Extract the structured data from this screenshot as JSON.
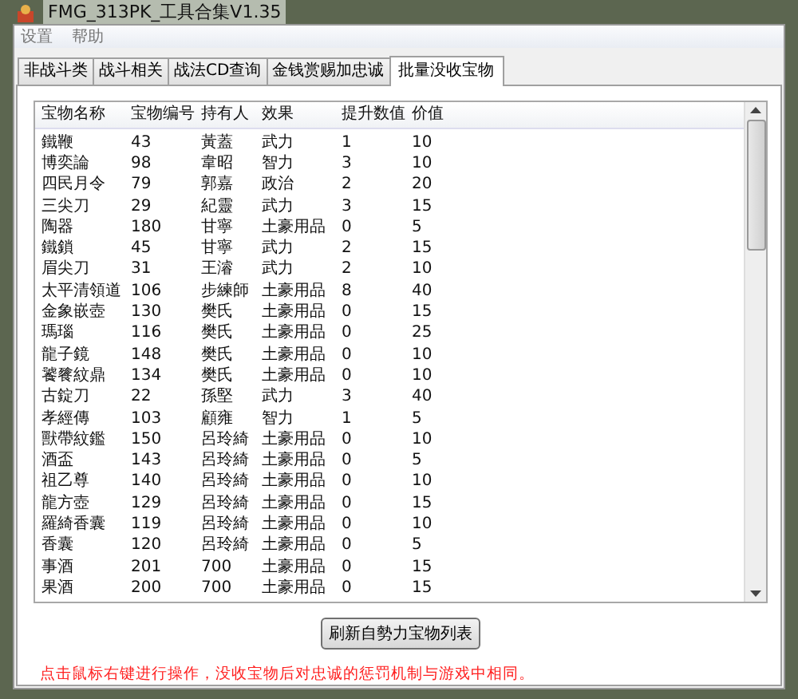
{
  "window": {
    "title": "FMG_313PK_工具合集V1.35"
  },
  "menu": [
    "设置",
    "帮助"
  ],
  "tabs": [
    {
      "label": "非战斗类",
      "selected": false
    },
    {
      "label": "战斗相关",
      "selected": false
    },
    {
      "label": "战法CD查询",
      "selected": false
    },
    {
      "label": "金钱赏赐加忠诚",
      "selected": false
    },
    {
      "label": "批量没收宝物",
      "selected": true
    }
  ],
  "table": {
    "columns": [
      "宝物名称",
      "宝物编号",
      "持有人",
      "效果",
      "提升数值",
      "价值"
    ],
    "rows": [
      [
        "鐵鞭",
        "43",
        "黃蓋",
        "武力",
        "1",
        "10"
      ],
      [
        "博奕論",
        "98",
        "韋昭",
        "智力",
        "3",
        "10"
      ],
      [
        "四民月令",
        "79",
        "郭嘉",
        "政治",
        "2",
        "20"
      ],
      [
        "三尖刀",
        "29",
        "紀靈",
        "武力",
        "3",
        "15"
      ],
      [
        "陶器",
        "180",
        "甘寧",
        "土豪用品",
        "0",
        "5"
      ],
      [
        "鐵鎖",
        "45",
        "甘寧",
        "武力",
        "2",
        "15"
      ],
      [
        "眉尖刀",
        "31",
        "王濬",
        "武力",
        "2",
        "10"
      ],
      [
        "太平清領道",
        "106",
        "步練師",
        "土豪用品",
        "8",
        "40"
      ],
      [
        "金象嵌壺",
        "130",
        "樊氏",
        "土豪用品",
        "0",
        "15"
      ],
      [
        "瑪瑙",
        "116",
        "樊氏",
        "土豪用品",
        "0",
        "25"
      ],
      [
        "龍子鏡",
        "148",
        "樊氏",
        "土豪用品",
        "0",
        "10"
      ],
      [
        "饕餮紋鼎",
        "134",
        "樊氏",
        "土豪用品",
        "0",
        "10"
      ],
      [
        "古錠刀",
        "22",
        "孫堅",
        "武力",
        "3",
        "40"
      ],
      [
        "孝經傳",
        "103",
        "顧雍",
        "智力",
        "1",
        "5"
      ],
      [
        "獸帶紋鑑",
        "150",
        "呂玲綺",
        "土豪用品",
        "0",
        "10"
      ],
      [
        "酒盃",
        "143",
        "呂玲綺",
        "土豪用品",
        "0",
        "5"
      ],
      [
        "祖乙尊",
        "140",
        "呂玲綺",
        "土豪用品",
        "0",
        "10"
      ],
      [
        "龍方壺",
        "129",
        "呂玲綺",
        "土豪用品",
        "0",
        "15"
      ],
      [
        "羅綺香囊",
        "119",
        "呂玲綺",
        "土豪用品",
        "0",
        "10"
      ],
      [
        "香囊",
        "120",
        "呂玲綺",
        "土豪用品",
        "0",
        "5"
      ],
      [
        "事酒",
        "201",
        "700",
        "土豪用品",
        "0",
        "15"
      ],
      [
        "果酒",
        "200",
        "700",
        "土豪用品",
        "0",
        "15"
      ]
    ]
  },
  "button": "刷新自勢力宝物列表",
  "note": "点击鼠标右键进行操作，没收宝物后对忠诚的惩罚机制与游戏中相同。"
}
